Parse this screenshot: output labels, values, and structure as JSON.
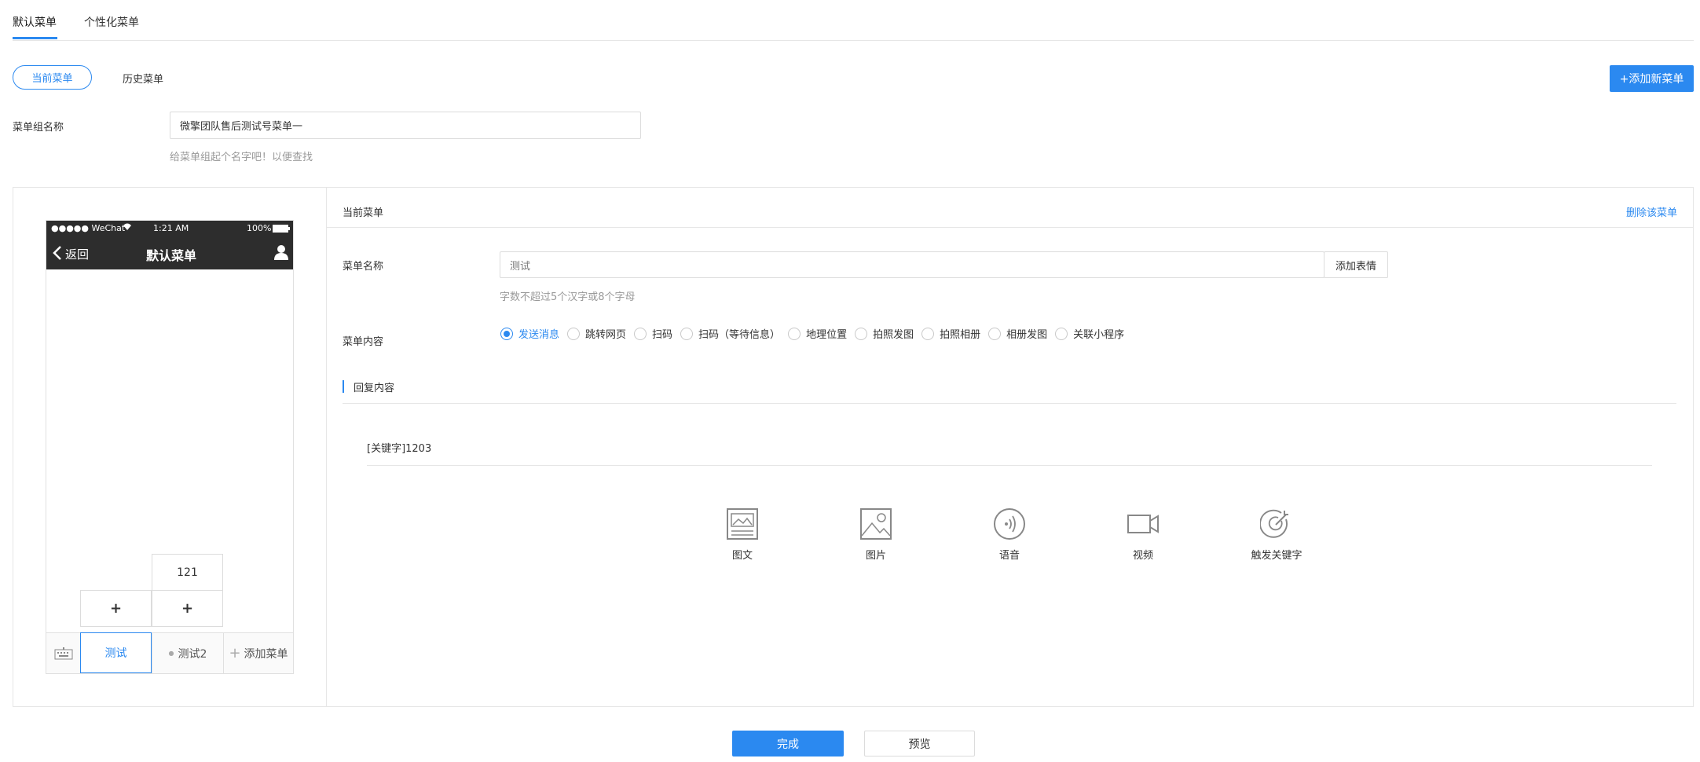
{
  "top_tabs": [
    "默认菜单",
    "个性化菜单"
  ],
  "sub_tabs": {
    "current": "当前菜单",
    "history": "历史菜单"
  },
  "add_menu_button": "+添加新菜单",
  "group_name": {
    "label": "菜单组名称",
    "value": "微擎团队售后测试号菜单一",
    "hint": "给菜单组起个名字吧！以便查找"
  },
  "phone": {
    "status_left": "●●●●● WeChat",
    "status_time": "1:21 AM",
    "status_battery": "100%",
    "back_label": "返回",
    "title": "默认菜单",
    "submenu_item": "121",
    "plus_symbol": "+",
    "bottom_menu": [
      "测试",
      "测试2",
      "添加菜单"
    ]
  },
  "editor": {
    "header_title": "当前菜单",
    "delete_link": "删除该菜单",
    "menu_name_label": "菜单名称",
    "menu_name_value": "测试",
    "emoji_button": "添加表情",
    "menu_name_hint": "字数不超过5个汉字或8个字母",
    "menu_content_label": "菜单内容",
    "content_options": [
      "发送消息",
      "跳转网页",
      "扫码",
      "扫码（等待信息）",
      "地理位置",
      "拍照发图",
      "拍照相册",
      "相册发图",
      "关联小程序"
    ],
    "selected_option": "发送消息",
    "reply_title": "回复内容",
    "keyword": "[关键字]1203",
    "media_types": [
      "图文",
      "图片",
      "语音",
      "视频",
      "触发关键字"
    ]
  },
  "footer": {
    "done": "完成",
    "preview": "预览"
  },
  "colors": {
    "accent": "#2b89f0",
    "phone_bar": "#2d2d2d"
  }
}
